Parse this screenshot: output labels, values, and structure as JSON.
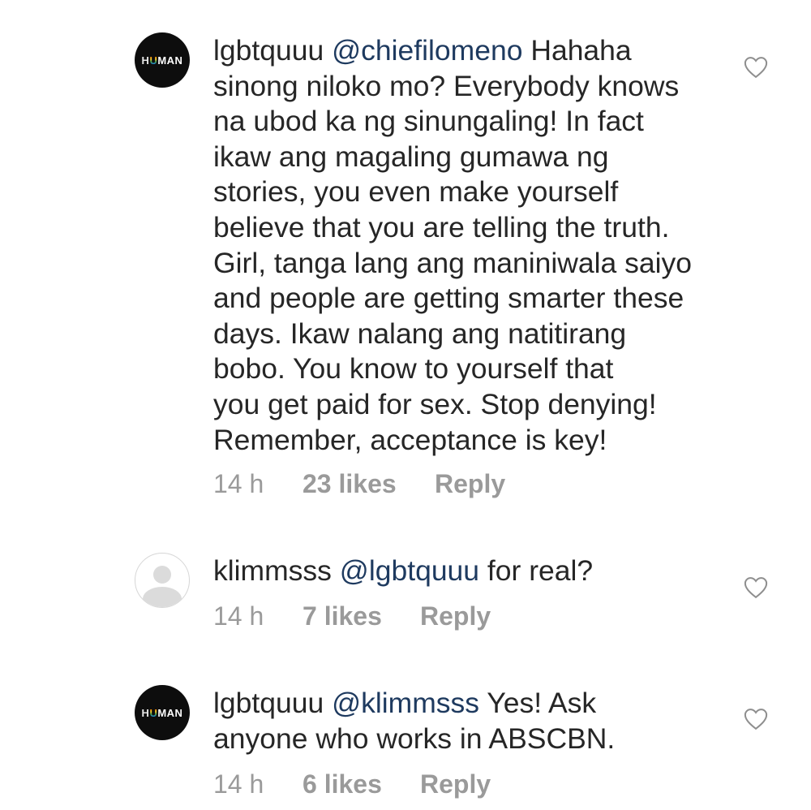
{
  "comments": [
    {
      "username": "lgbtquuu",
      "avatar_text": "HUMAN",
      "mention": "@chiefilomeno",
      "lines": [
        "Hahaha",
        "sinong niloko mo? Everybody knows",
        "na ubod ka ng sinungaling! In fact",
        "ikaw ang magaling gumawa ng",
        "stories, you even make yourself",
        "believe that you are telling the truth.",
        "Girl, tanga lang ang maniniwala saiyo",
        "and people are getting smarter these",
        "days. Ikaw nalang ang natitirang",
        "bobo. You know to yourself that",
        "you get paid for sex. Stop denying!",
        "Remember, acceptance is key!"
      ],
      "time": "14 h",
      "likes": "23 likes",
      "reply": "Reply",
      "like_icon": "heart-outline-icon"
    },
    {
      "username": "klimmsss",
      "avatar_text": "",
      "mention": "@lgbtquuu",
      "lines": [
        "for real?"
      ],
      "time": "14 h",
      "likes": "7 likes",
      "reply": "Reply",
      "like_icon": "heart-outline-icon"
    },
    {
      "username": "lgbtquuu",
      "avatar_text": "HUMAN",
      "mention": "@klimmsss",
      "lines": [
        "Yes! Ask",
        "anyone who works in ABSCBN."
      ],
      "time": "14 h",
      "likes": "6 likes",
      "reply": "Reply",
      "like_icon": "heart-outline-icon"
    }
  ]
}
